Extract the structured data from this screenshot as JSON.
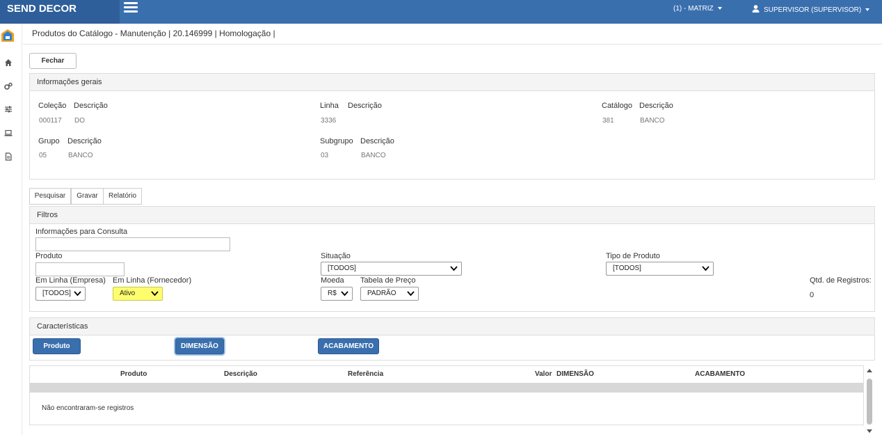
{
  "app": {
    "brand": "SEND DECOR",
    "branch": "(1) - MATRIZ",
    "user": "SUPERVISOR (SUPERVISOR)"
  },
  "page": {
    "breadcrumb": "Produtos do Catálogo - Manutenção | 20.146999 | Homologação |"
  },
  "actions": {
    "close_label": "Fechar"
  },
  "general_info": {
    "title": "Informações gerais",
    "colecao_label": "Coleção",
    "colecao_value": "000117",
    "colecao_desc_label": "Descrição",
    "colecao_desc_value": "DO",
    "linha_label": "Linha",
    "linha_value": "3336",
    "linha_desc_label": "Descrição",
    "catalogo_label": "Catálogo",
    "catalogo_value": "381",
    "catalogo_desc_label": "Descrição",
    "catalogo_desc_value": "BANCO",
    "grupo_label": "Grupo",
    "grupo_value": "05",
    "grupo_desc_label": "Descrição",
    "grupo_desc_value": "BANCO",
    "subgrupo_label": "Subgrupo",
    "subgrupo_value": "03",
    "subgrupo_desc_label": "Descrição",
    "subgrupo_desc_value": "BANCO"
  },
  "tabs": [
    "Pesquisar",
    "Gravar",
    "Relatório"
  ],
  "filters": {
    "title": "Filtros",
    "consulta_label": "Informações para Consulta",
    "produto_label": "Produto",
    "situacao_label": "Situação",
    "situacao_value": "[TODOS]",
    "tipo_label": "Tipo de Produto",
    "tipo_value": "[TODOS]",
    "linha_empresa_label": "Em Linha (Empresa)",
    "linha_empresa_value": "[TODOS]",
    "linha_fornecedor_label": "Em Linha (Fornecedor)",
    "linha_fornecedor_value": "Ativo",
    "moeda_label": "Moeda",
    "moeda_value": "R$",
    "tabela_label": "Tabela de Preço",
    "tabela_value": "PADRÃO",
    "qtd_label": "Qtd. de Registros:",
    "qtd_value": "0"
  },
  "characteristics": {
    "title": "Características",
    "buttons": [
      "Produto",
      "DIMENSÃO",
      "ACABAMENTO"
    ]
  },
  "grid": {
    "columns": [
      "Produto",
      "Descrição",
      "Referência",
      "Valor",
      "DIMENSÃO",
      "ACABAMENTO"
    ],
    "empty_message": "Não encontraram-se registros"
  },
  "colors": {
    "header": "#3a6fae",
    "brand_bg": "#2f5f9a",
    "highlight": "#fdfd6e"
  }
}
